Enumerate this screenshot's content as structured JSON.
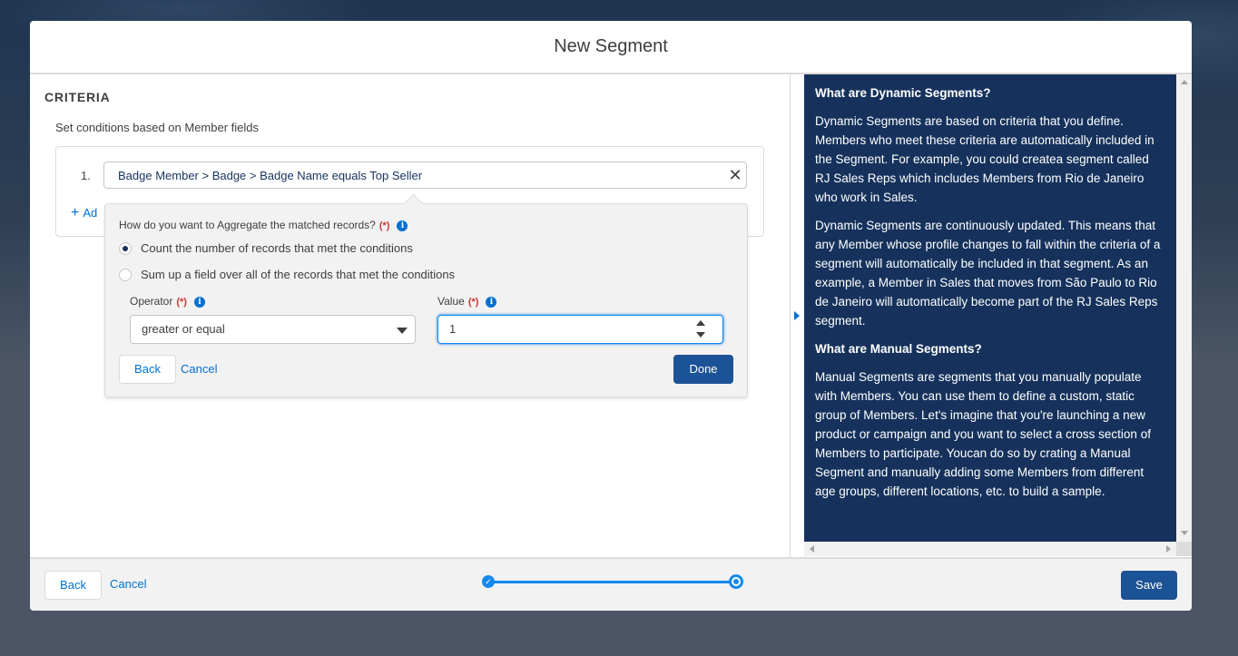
{
  "modal": {
    "title": "New Segment"
  },
  "criteria": {
    "heading": "CRITERIA",
    "subtext": "Set conditions based on Member fields",
    "condition_number": "1.",
    "condition_text": "Badge Member > Badge > Badge Name equals Top Seller",
    "close_glyph": "✕",
    "add_label": "Ad"
  },
  "aggregate": {
    "question": "How do you want to Aggregate the matched records?",
    "required_mark": "(*)",
    "options": [
      {
        "label": "Count the number of records that met the conditions",
        "checked": true
      },
      {
        "label": "Sum up a field over all of the records that met the conditions",
        "checked": false
      }
    ],
    "operator_label": "Operator",
    "operator_value": "greater or equal",
    "value_label": "Value",
    "value": "1",
    "back_label": "Back",
    "cancel_label": "Cancel",
    "done_label": "Done"
  },
  "help": {
    "heading1": "What are Dynamic Segments?",
    "p1": "Dynamic Segments are based on criteria that you define. Members who meet these criteria are automatically included in the Segment. For example, you could createa segment called RJ Sales Reps which includes Members from Rio de Janeiro who work in Sales.",
    "p2": "Dynamic Segments are continuously updated. This means that any Member whose profile changes to fall within the criteria of a segment will automatically be included in that segment. As an example, a Member in Sales that moves from São Paulo to Rio de Janeiro will automatically become part of the RJ Sales Reps segment.",
    "heading2": "What are Manual Segments?",
    "p3": "Manual Segments are segments that you manually populate with Members. You can use them to define a custom, static group of Members. Let's imagine that you're launching a new product or campaign and you want to select a cross section of Members to participate. Youcan do so by crating a Manual Segment and manually adding some Members from different age groups, different locations, etc. to build a sample."
  },
  "footer": {
    "back_label": "Back",
    "cancel_label": "Cancel",
    "save_label": "Save"
  },
  "progress": {
    "steps": 2,
    "current_step": 2
  },
  "colors": {
    "brand": "#1c5296",
    "link": "#0070d2",
    "help_bg": "#16325c",
    "required": "#c23934"
  }
}
